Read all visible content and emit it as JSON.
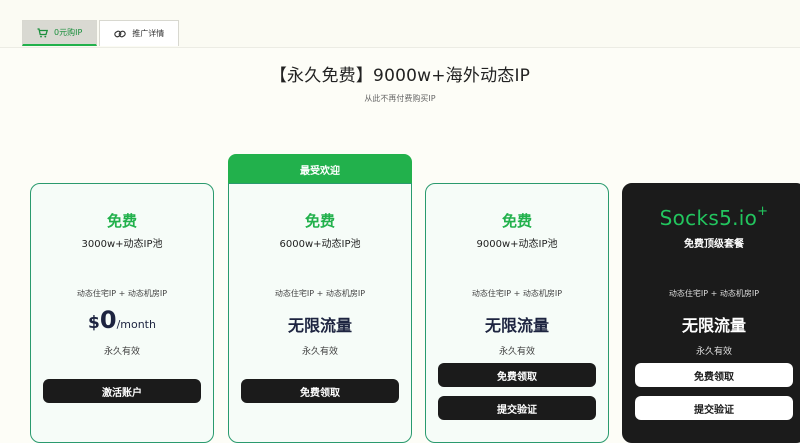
{
  "tabs": [
    {
      "label": "0元购IP",
      "icon": "cart-icon",
      "active": true
    },
    {
      "label": "推广详情",
      "icon": "link-icon",
      "active": false
    }
  ],
  "hero": {
    "title": "【永久免费】9000w+海外动态IP",
    "subtitle": "从此不再付费购买IP"
  },
  "banner": {
    "label": "最受欢迎"
  },
  "colors": {
    "accent": "#22b14c",
    "dark": "#1b1b1b",
    "border": "#2a9a6e",
    "heading": "#1d2440"
  },
  "cards": [
    {
      "title": "免费",
      "pool": "3000w+动态IP池",
      "types": "动态住宅IP + 动态机房IP",
      "price_symbol": "$",
      "price_value": "0",
      "price_period": "/month",
      "validity": "永久有效",
      "button1": "激活账户"
    },
    {
      "title": "免费",
      "pool": "6000w+动态IP池",
      "types": "动态住宅IP + 动态机房IP",
      "traffic": "无限流量",
      "validity": "永久有效",
      "button1": "免费领取"
    },
    {
      "title": "免费",
      "pool": "9000w+动态IP池",
      "types": "动态住宅IP + 动态机房IP",
      "traffic": "无限流量",
      "validity": "永久有效",
      "button1": "免费领取",
      "button2": "提交验证"
    },
    {
      "brand": "Socks5.io",
      "brand_sup": "+",
      "pool": "免费顶级套餐",
      "types": "动态住宅IP + 动态机房IP",
      "traffic": "无限流量",
      "validity": "永久有效",
      "button1": "免费领取",
      "button2": "提交验证"
    }
  ]
}
